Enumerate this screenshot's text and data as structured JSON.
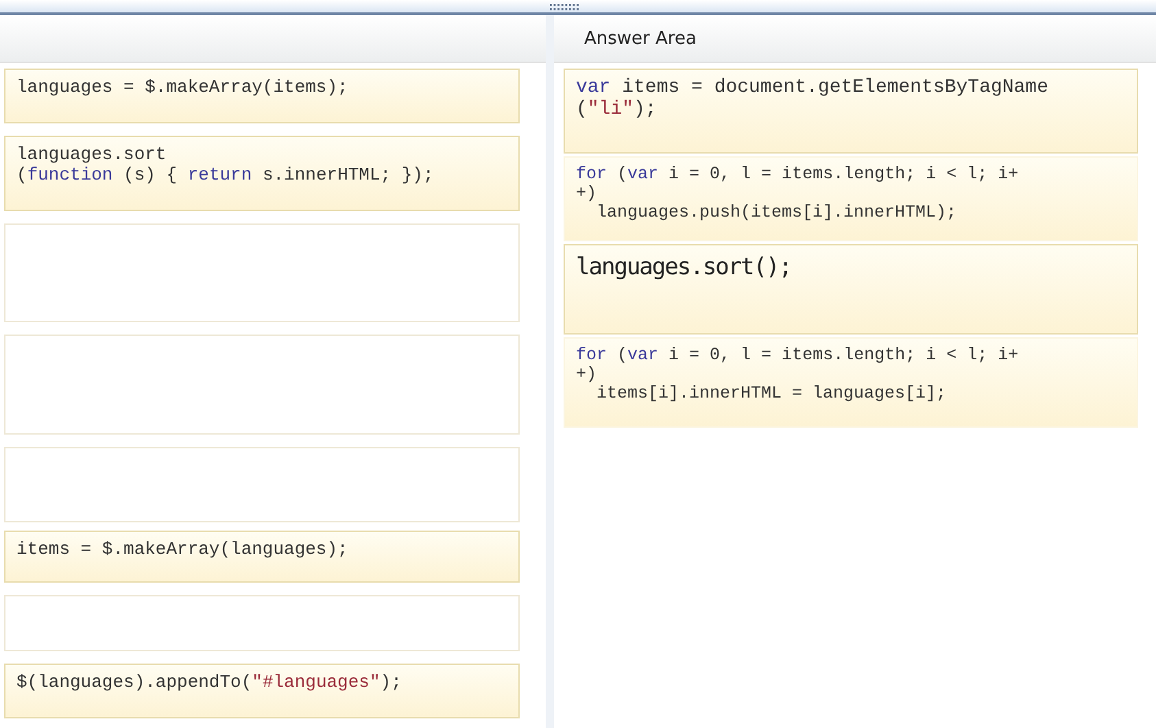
{
  "answer_area": {
    "title": "Answer Area"
  },
  "source_tiles": [
    {
      "kind": "code",
      "lines": [
        [
          {
            "text": "languages = $.makeArray(items);",
            "kind": "plain"
          }
        ]
      ]
    },
    {
      "kind": "code",
      "lines": [
        [
          {
            "text": "languages.sort",
            "kind": "plain"
          }
        ],
        [
          {
            "text": "(",
            "kind": "plain"
          },
          {
            "text": "function",
            "kind": "keyword"
          },
          {
            "text": " (s) { ",
            "kind": "plain"
          },
          {
            "text": "return",
            "kind": "keyword"
          },
          {
            "text": " s.innerHTML; });",
            "kind": "plain"
          }
        ]
      ]
    },
    {
      "kind": "empty"
    },
    {
      "kind": "empty"
    },
    {
      "kind": "empty"
    },
    {
      "kind": "code",
      "lines": [
        [
          {
            "text": "items = $.makeArray(languages);",
            "kind": "plain"
          }
        ]
      ]
    },
    {
      "kind": "empty"
    },
    {
      "kind": "code",
      "lines": [
        [
          {
            "text": "$(languages).appendTo(",
            "kind": "plain"
          },
          {
            "text": "\"#languages\"",
            "kind": "string"
          },
          {
            "text": ");",
            "kind": "plain"
          }
        ]
      ]
    }
  ],
  "answer_tiles": [
    {
      "kind": "code",
      "lines": [
        [
          {
            "text": "var",
            "kind": "keyword"
          },
          {
            "text": " items = document.getElementsByTagName",
            "kind": "plain"
          }
        ],
        [
          {
            "text": "(",
            "kind": "plain"
          },
          {
            "text": "\"li\"",
            "kind": "string"
          },
          {
            "text": ");",
            "kind": "plain"
          }
        ]
      ]
    },
    {
      "kind": "code",
      "lines": [
        [
          {
            "text": "for",
            "kind": "keyword"
          },
          {
            "text": " (",
            "kind": "plain"
          },
          {
            "text": "var",
            "kind": "keyword"
          },
          {
            "text": " i = 0, l = items.length; i < l; i+",
            "kind": "plain"
          }
        ],
        [
          {
            "text": "+)",
            "kind": "plain"
          }
        ],
        [
          {
            "text": "  languages.push(items[i].innerHTML);",
            "kind": "plain"
          }
        ]
      ]
    },
    {
      "kind": "large",
      "lines": [
        [
          {
            "text": "languages.sort();",
            "kind": "plain"
          }
        ]
      ]
    },
    {
      "kind": "code",
      "lines": [
        [
          {
            "text": "for",
            "kind": "keyword"
          },
          {
            "text": " (",
            "kind": "plain"
          },
          {
            "text": "var",
            "kind": "keyword"
          },
          {
            "text": " i = 0, l = items.length; i < l; i+",
            "kind": "plain"
          }
        ],
        [
          {
            "text": "+)",
            "kind": "plain"
          }
        ],
        [
          {
            "text": "  items[i].innerHTML = languages[i];",
            "kind": "plain"
          }
        ]
      ]
    }
  ]
}
